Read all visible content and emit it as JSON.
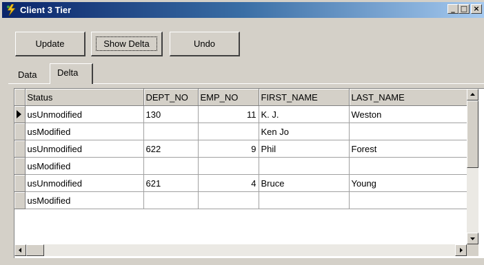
{
  "window": {
    "title": "Client 3 Tier"
  },
  "toolbar": {
    "update_label": "Update",
    "show_delta_label": "Show Delta",
    "undo_label": "Undo"
  },
  "tabs": [
    {
      "label": "Data"
    },
    {
      "label": "Delta"
    }
  ],
  "grid": {
    "columns": [
      "Status",
      "DEPT_NO",
      "EMP_NO",
      "FIRST_NAME",
      "LAST_NAME"
    ],
    "rows": [
      {
        "status": "usUnmodified",
        "dept_no": "130",
        "emp_no": "11",
        "first_name": "K. J.",
        "last_name": "Weston"
      },
      {
        "status": "usModified",
        "dept_no": "",
        "emp_no": "",
        "first_name": "Ken Jo",
        "last_name": ""
      },
      {
        "status": "usUnmodified",
        "dept_no": "622",
        "emp_no": "9",
        "first_name": "Phil",
        "last_name": "Forest"
      },
      {
        "status": "usModified",
        "dept_no": "",
        "emp_no": "",
        "first_name": "",
        "last_name": ""
      },
      {
        "status": "usUnmodified",
        "dept_no": "621",
        "emp_no": "4",
        "first_name": "Bruce",
        "last_name": "Young"
      },
      {
        "status": "usModified",
        "dept_no": "",
        "emp_no": "",
        "first_name": "",
        "last_name": ""
      }
    ]
  },
  "icons": {
    "app": "lightning-app-icon",
    "minimize": "minimize-icon",
    "maximize": "maximize-icon",
    "close": "close-icon",
    "current_row": "current-row-indicator-icon"
  }
}
